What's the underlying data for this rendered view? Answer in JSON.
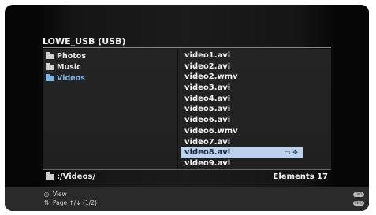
{
  "device": {
    "title": "LOWE_USB (USB)"
  },
  "folders": [
    {
      "label": "Photos",
      "active": false
    },
    {
      "label": "Music",
      "active": false
    },
    {
      "label": "Videos",
      "active": true
    }
  ],
  "files": [
    "video1.avi",
    "video2.avi",
    "video2.wmv",
    "video3.avi",
    "video4.avi",
    "video5.avi",
    "video6.avi",
    "video6.wmv",
    "video7.avi",
    "video8.avi",
    "video9.avi"
  ],
  "selected_index": 9,
  "path": ":/Videos/",
  "elements": "Elements 17",
  "help": {
    "view": "View",
    "page": "Page ↑/↓ (1/2)"
  },
  "colors": {
    "selection": "#bcd2ee",
    "active_folder": "#7fb2e8",
    "background": "#050505"
  },
  "icons": {
    "folder": "folder-icon",
    "view": "ok-button-icon",
    "page": "page-arrows-icon",
    "end_button": "end-button-icon",
    "info_button": "info-button-icon"
  }
}
